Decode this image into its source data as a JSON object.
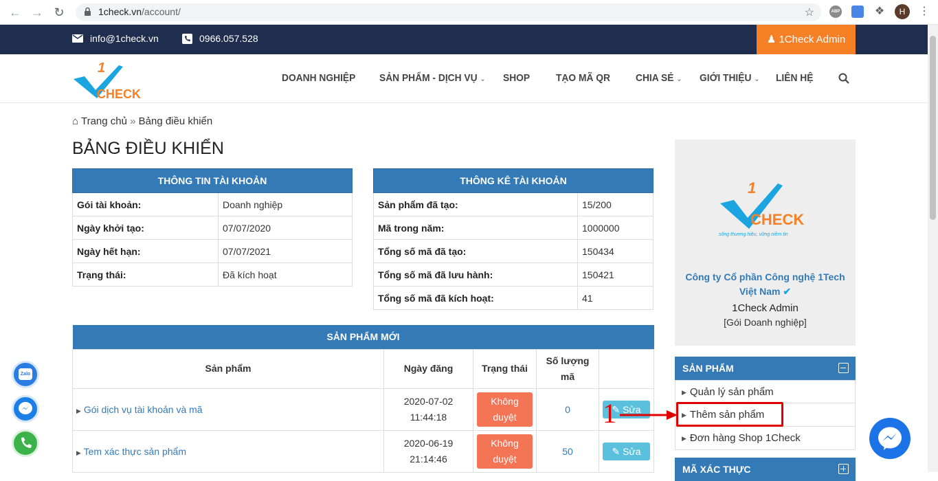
{
  "browser": {
    "url_host": "1check.vn",
    "url_path": "/account/",
    "profile_initial": "H",
    "abp_label": "ABP"
  },
  "topbar": {
    "email": "info@1check.vn",
    "phone": "0966.057.528",
    "admin_button": "1Check Admin"
  },
  "logo": {
    "text": "CHECK",
    "mark": "1"
  },
  "menu": {
    "items": [
      {
        "label": "DOANH NGHIỆP",
        "has_dropdown": false
      },
      {
        "label": "SẢN PHẨM - DỊCH VỤ",
        "has_dropdown": true
      },
      {
        "label": "SHOP",
        "has_dropdown": false
      },
      {
        "label": "TẠO MÃ QR",
        "has_dropdown": false
      },
      {
        "label": "CHIA SẺ",
        "has_dropdown": true
      },
      {
        "label": "GIỚI THIỆU",
        "has_dropdown": true
      },
      {
        "label": "LIÊN HỆ",
        "has_dropdown": false
      }
    ]
  },
  "breadcrumb": {
    "home": "Trang chủ",
    "sep": "»",
    "current": "Bảng điều khiển"
  },
  "page_title": "BẢNG ĐIỀU KHIỂN",
  "account_info": {
    "title": "THÔNG TIN TÀI KHOẢN",
    "rows": [
      {
        "k": "Gói tài khoản:",
        "v": "Doanh nghiệp"
      },
      {
        "k": "Ngày khởi tạo:",
        "v": "07/07/2020"
      },
      {
        "k": "Ngày hết hạn:",
        "v": "07/07/2021"
      },
      {
        "k": "Trạng thái:",
        "v": "Đã kích hoạt"
      }
    ]
  },
  "account_stats": {
    "title": "THÔNG KÊ TÀI KHOẢN",
    "rows": [
      {
        "k": "Sản phẩm đã tạo:",
        "v": "15/200"
      },
      {
        "k": "Mã trong năm:",
        "v": "1000000"
      },
      {
        "k": "Tổng số mã đã tạo:",
        "v": "150434"
      },
      {
        "k": "Tổng số mã đã lưu hành:",
        "v": "150421"
      },
      {
        "k": "Tổng số mã đã kích hoạt:",
        "v": "41"
      }
    ]
  },
  "new_products": {
    "title": "SẢN PHẨM MỚI",
    "headers": {
      "product": "Sản phẩm",
      "date": "Ngày đăng",
      "status": "Trạng thái",
      "qty_1": "Số lượng",
      "qty_2": "mã"
    },
    "rows": [
      {
        "name": "Gói dịch vụ tài khoản và mã",
        "date": "2020-07-02",
        "time": "11:44:18",
        "status_1": "Không",
        "status_2": "duyệt",
        "qty": "0",
        "action": "Sửa"
      },
      {
        "name": "Tem xác thực sản phẩm",
        "date": "2020-06-19",
        "time": "21:14:46",
        "status_1": "Không",
        "status_2": "duyệt",
        "qty": "50",
        "action": "Sửa"
      }
    ]
  },
  "sidebar": {
    "logo_text": "CHECK",
    "logo_mark": "1",
    "slogan": "sống thương hiệu, vững niềm tin",
    "company": "Công ty Cổ phần Công nghệ 1Tech Việt Nam",
    "admin_name": "1Check Admin",
    "plan": "[Gói Doanh nghiệp]",
    "products_panel": {
      "title": "SẢN PHẨM",
      "links": [
        "Quản lý sản phẩm",
        "Thêm sản phẩm",
        "Đơn hàng Shop 1Check"
      ]
    },
    "codes_panel": {
      "title": "MÃ XÁC THỰC"
    }
  },
  "annotation": {
    "number": "1",
    "color": "#e00000"
  },
  "floating": {
    "zalo_label": "Zalo"
  },
  "colors": {
    "navy": "#1f2d4e",
    "orange": "#f58025",
    "blue": "#337ab7",
    "status": "#f47456",
    "edit": "#5bc0de"
  }
}
